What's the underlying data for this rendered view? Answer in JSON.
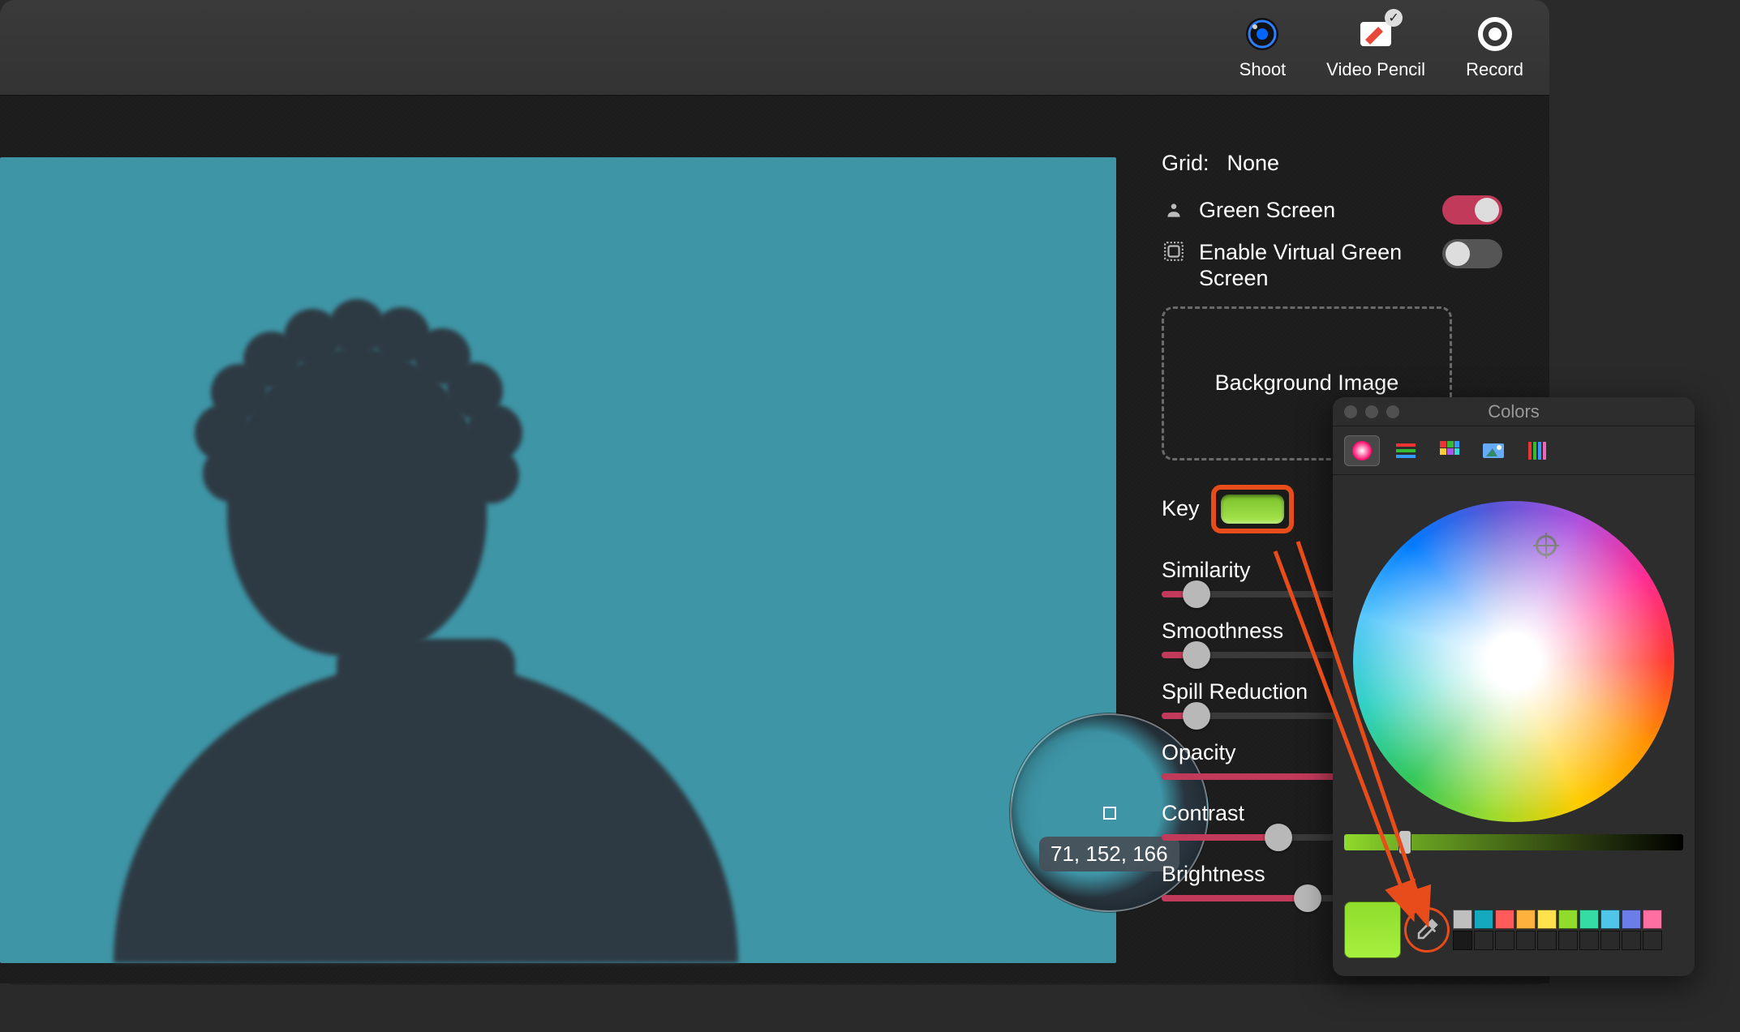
{
  "toolbar": {
    "shoot": {
      "label": "Shoot"
    },
    "pencil": {
      "label": "Video Pencil"
    },
    "record": {
      "label": "Record"
    }
  },
  "sidepanel": {
    "grid_label": "Grid:",
    "grid_value": "None",
    "green_screen_label": "Green Screen",
    "green_screen_on": true,
    "virtual_label": "Enable Virtual Green Screen",
    "virtual_on": false,
    "bg_image_label": "Background Image",
    "key_label": "Key",
    "key_color": "#8fdc2c",
    "sliders": [
      {
        "label": "Similarity",
        "value": 0.12
      },
      {
        "label": "Smoothness",
        "value": 0.12
      },
      {
        "label": "Spill Reduction",
        "value": 0.12
      },
      {
        "label": "Opacity",
        "value": 1.0
      },
      {
        "label": "Contrast",
        "value": 0.4
      },
      {
        "label": "Brightness",
        "value": 0.5
      }
    ]
  },
  "magnifier": {
    "rgb_text": "71, 152, 166"
  },
  "color_popover": {
    "title": "Colors",
    "presets_row1": [
      "#bfbfbf",
      "#14a9bf",
      "#ff5b5b",
      "#ffb13d",
      "#ffe14d",
      "#8fdc2c",
      "#35dca4",
      "#4fc6e8",
      "#6a7de8",
      "#ff6fa1"
    ],
    "presets_row2": [
      "#1a1a1a",
      "#2a2a2a",
      "#2a2a2a",
      "#2a2a2a",
      "#2a2a2a",
      "#2a2a2a",
      "#2a2a2a",
      "#2a2a2a",
      "#2a2a2a",
      "#2a2a2a"
    ]
  }
}
